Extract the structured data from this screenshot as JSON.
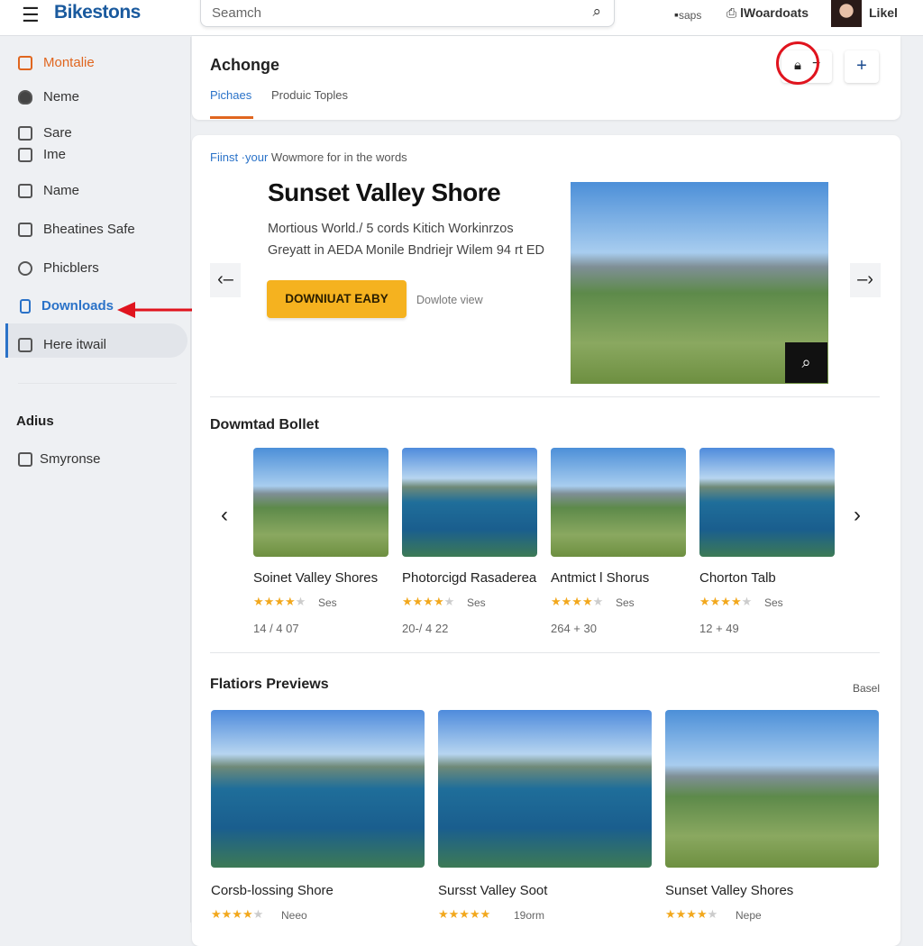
{
  "header": {
    "brand": "Bikestons",
    "search_placeholder": "Seamch",
    "apps_label": "saps",
    "downloads_label": "lWoardoats",
    "user_name": "Likel"
  },
  "sidebar": {
    "items": [
      {
        "label": "Montalie",
        "icon": "calendar-icon",
        "color": "#e0661f"
      },
      {
        "label": "Neme",
        "icon": "shield-icon"
      },
      {
        "label": "Sare",
        "icon": "grid-icon"
      },
      {
        "label": "Ime",
        "icon": "tag-icon"
      },
      {
        "label": "Name",
        "icon": "inbox-icon"
      },
      {
        "label": "Bheatines Safe",
        "icon": "printer-icon"
      },
      {
        "label": "Phicblers",
        "icon": "power-icon"
      },
      {
        "label": "Downloads",
        "icon": "file-icon",
        "active": true
      },
      {
        "label": "Here itwail",
        "icon": "monitor-icon"
      }
    ],
    "section": "Adius",
    "section_items": [
      {
        "label": "Smyronse",
        "icon": "tv-icon"
      }
    ]
  },
  "topcard": {
    "title": "Achonge",
    "tabs": [
      {
        "label": "Pichaes",
        "active": true
      },
      {
        "label": "Produic Toples"
      }
    ]
  },
  "hero": {
    "kicker_accent": "Fiinst ·your",
    "kicker": "Wowmore for in the words",
    "title": "Sunset Valley Shore",
    "desc1": "Mortious World./ 5 cords Kitich Workinrzos",
    "desc2": "Greyatt in AEDA Monile Bndriejr Wilem 94 rt ED",
    "cta": "DOWNIUAT EABY",
    "secondary": "Dowlote view"
  },
  "carousel": {
    "title": "Dowmtad Bollet",
    "items": [
      {
        "title": "Soinet Valley Shores",
        "rating": 4,
        "meta": "Ses",
        "stats": "14 / 4 07"
      },
      {
        "title": "Photorcigd Rasaderea",
        "rating": 4,
        "meta": "Ses",
        "stats": "20-/ 4 22"
      },
      {
        "title": "Antmict l Shorus",
        "rating": 4,
        "meta": "Ses",
        "stats": "264 + 30"
      },
      {
        "title": "Chorton Talb",
        "rating": 4,
        "meta": "Ses",
        "stats": "12 + 49"
      }
    ]
  },
  "previews": {
    "title": "Flatiors Previews",
    "link": "Basel",
    "items": [
      {
        "title": "Corsb-lossing Shore",
        "rating": 4,
        "meta": "Neeo"
      },
      {
        "title": "Sursst Valley Soot",
        "rating": 5,
        "meta": "19orm"
      },
      {
        "title": "Sunset Valley Shores",
        "rating": 4,
        "meta": "Nepe"
      }
    ]
  },
  "colors": {
    "accent": "#e0661f",
    "link": "#2a72c8",
    "cta": "#f5b21f",
    "annotation": "#e0141e"
  }
}
